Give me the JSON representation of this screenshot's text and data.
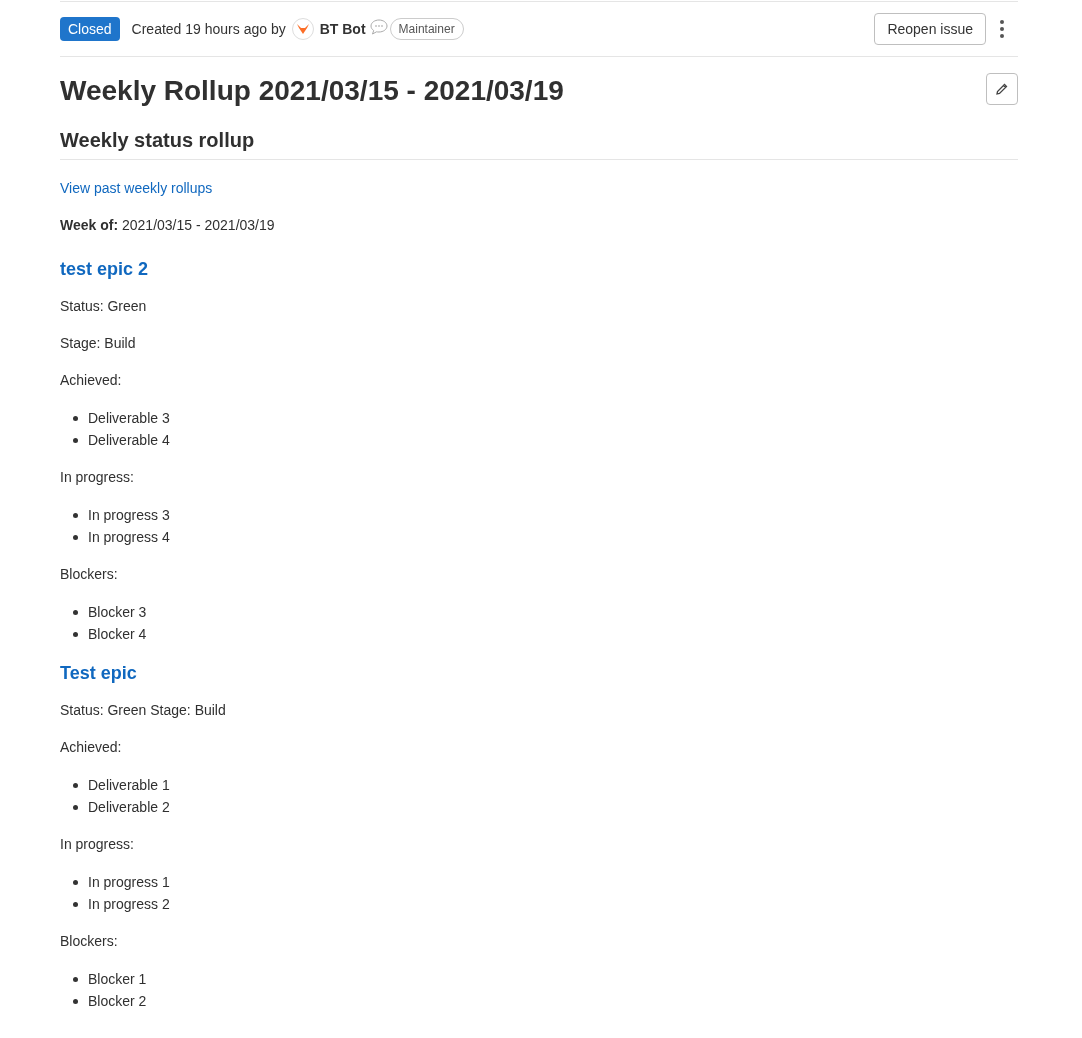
{
  "header": {
    "status": "Closed",
    "created_text": "Created 19 hours ago by",
    "author": "BT Bot",
    "role": "Maintainer",
    "reopen_button": "Reopen issue"
  },
  "title": "Weekly Rollup 2021/03/15 - 2021/03/19",
  "description": {
    "heading": "Weekly status rollup",
    "link": "View past weekly rollups",
    "week_of": "**Week of:** 2021/03/15 - 2021/03/19",
    "epics": [
      {
        "title": "test epic 2",
        "blocks": [
          {
            "kind": "paragraph",
            "text": "Status: Green"
          },
          {
            "kind": "paragraph",
            "text": "Stage: Build"
          },
          {
            "kind": "paragraph",
            "text": "Achieved:"
          },
          {
            "kind": "list",
            "items": [
              "Deliverable 3",
              "Deliverable 4"
            ]
          },
          {
            "kind": "paragraph",
            "text": "In progress:"
          },
          {
            "kind": "list",
            "items": [
              "In progress 3",
              "In progress 4"
            ]
          },
          {
            "kind": "paragraph",
            "text": "Blockers:"
          },
          {
            "kind": "list",
            "items": [
              "Blocker 3",
              "Blocker 4"
            ]
          }
        ]
      },
      {
        "title": "Test epic",
        "blocks": [
          {
            "kind": "paragraph",
            "text": "Status: Green Stage: Build"
          },
          {
            "kind": "paragraph",
            "text": "Achieved:"
          },
          {
            "kind": "list",
            "items": [
              "Deliverable 1",
              "Deliverable 2"
            ]
          },
          {
            "kind": "paragraph",
            "text": "In progress:"
          },
          {
            "kind": "list",
            "items": [
              "In progress 1",
              "In progress 2"
            ]
          },
          {
            "kind": "paragraph",
            "text": "Blockers:"
          },
          {
            "kind": "list",
            "items": [
              "Blocker 1",
              "Blocker 2"
            ]
          }
        ]
      }
    ]
  }
}
